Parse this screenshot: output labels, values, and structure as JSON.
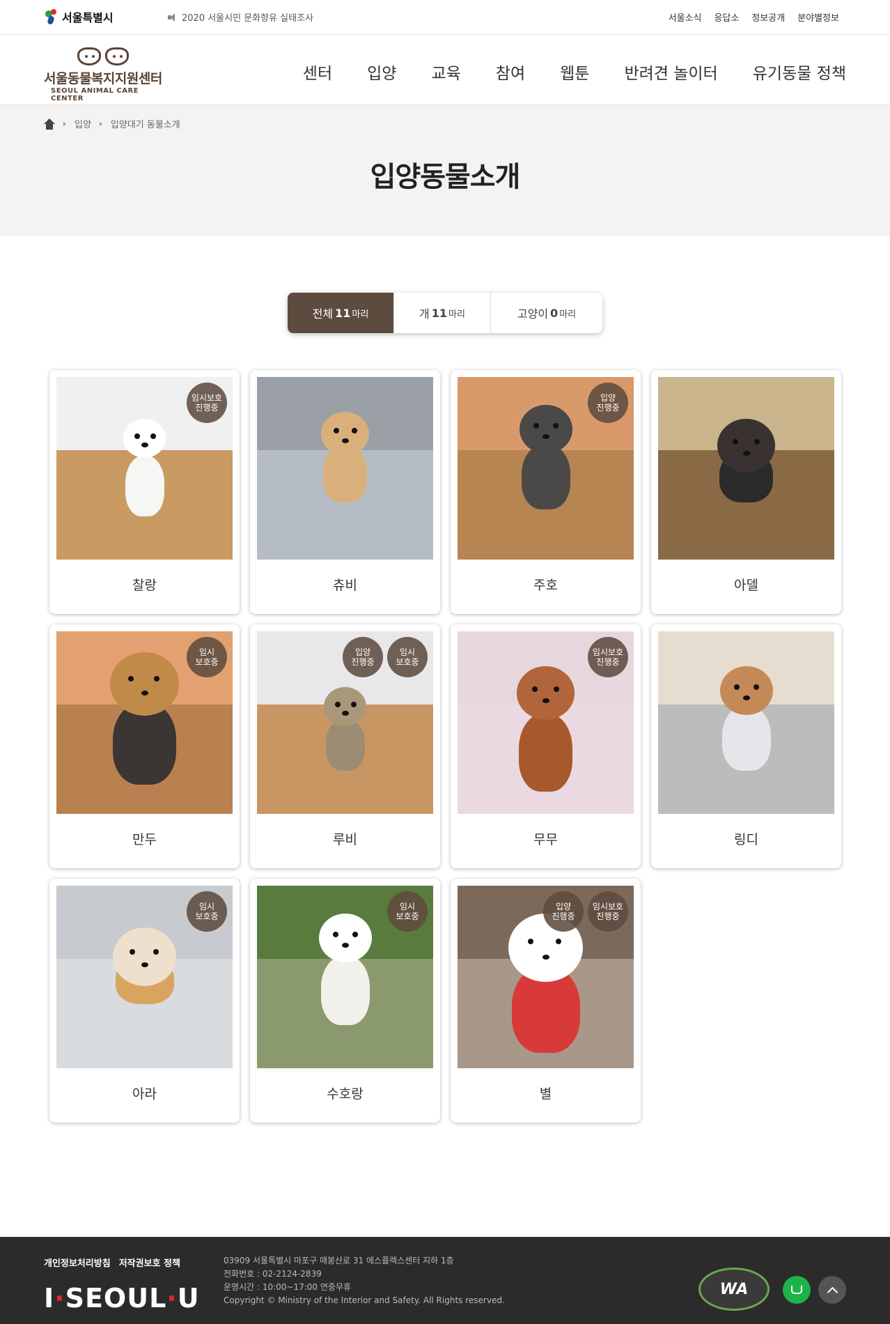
{
  "topbar": {
    "seoul_logo": "서울특별시",
    "notice": "2020 서울시민 문화향유 실태조사",
    "links": [
      "서울소식",
      "응답소",
      "정보공개",
      "분야별정보"
    ]
  },
  "header": {
    "logo_name": "서울동물복지지원센터",
    "logo_eng": "SEOUL ANIMAL CARE CENTER",
    "nav": [
      "센터",
      "입양",
      "교육",
      "참여",
      "웹툰",
      "반려견 놀이터",
      "유기동물 정책"
    ]
  },
  "breadcrumb": [
    "입양",
    "입양대기 동물소개"
  ],
  "page_title": "입양동물소개",
  "tabs": [
    {
      "label": "전체",
      "count": "11",
      "unit": "마리",
      "active": true
    },
    {
      "label": "개",
      "count": "11",
      "unit": "마리",
      "active": false
    },
    {
      "label": "고양이",
      "count": "0",
      "unit": "마리",
      "active": false
    }
  ],
  "animals": [
    {
      "name": "찰랑",
      "badges": [
        "임시보호\n진행중"
      ]
    },
    {
      "name": "츄비",
      "badges": []
    },
    {
      "name": "주호",
      "badges": [
        "입양\n진행중"
      ]
    },
    {
      "name": "아델",
      "badges": []
    },
    {
      "name": "만두",
      "badges": [
        "임시\n보호중"
      ]
    },
    {
      "name": "루비",
      "badges": [
        "입양\n진행중",
        "임시\n보호중"
      ]
    },
    {
      "name": "무무",
      "badges": [
        "임시보호\n진행중"
      ]
    },
    {
      "name": "링디",
      "badges": []
    },
    {
      "name": "아라",
      "badges": [
        "임시\n보호중"
      ]
    },
    {
      "name": "수호랑",
      "badges": [
        "임시\n보호중"
      ]
    },
    {
      "name": "별",
      "badges": [
        "입양\n진행중",
        "임시보호\n진행중"
      ]
    }
  ],
  "footer": {
    "links": [
      "개인정보처리방침",
      "저작권보호 정책"
    ],
    "brand_i": "I",
    "brand_seoul": "SEOUL",
    "brand_u": "U",
    "info": [
      "03909 서울특별시 마포구 매봉산로 31 에스플렉스센터 지하 1층",
      "전화번호 : 02-2124-2839",
      "운영시간 : 10:00~17:00 연중무휴",
      "Copyright © Ministry of the Interior and Safety. All Rights reserved."
    ],
    "wa": "WA"
  },
  "colors": {
    "accent": "#5e4b3f",
    "footer_bg": "#2b2b2b",
    "title_bg": "#f4f3f2"
  }
}
